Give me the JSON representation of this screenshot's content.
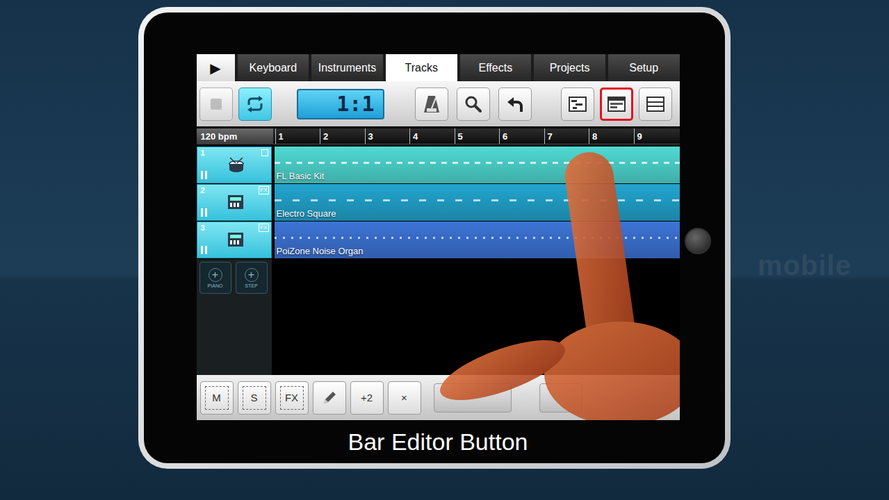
{
  "play_button": "▶",
  "tabs": [
    {
      "label": "Keyboard",
      "selected": false
    },
    {
      "label": "Instruments",
      "selected": false
    },
    {
      "label": "Tracks",
      "selected": true
    },
    {
      "label": "Effects",
      "selected": false
    },
    {
      "label": "Projects",
      "selected": false
    },
    {
      "label": "Setup",
      "selected": false
    }
  ],
  "toolbar": {
    "transport": [
      {
        "kind": "stop",
        "selected": false,
        "disabled": true
      },
      {
        "kind": "loop",
        "selected": true,
        "disabled": false
      }
    ],
    "display": "1:1",
    "tools": [
      {
        "kind": "metronome"
      },
      {
        "kind": "zoom"
      },
      {
        "kind": "undo"
      }
    ],
    "views": [
      {
        "kind": "piano-roll",
        "selected": false
      },
      {
        "kind": "bar-editor",
        "selected": true
      },
      {
        "kind": "list",
        "selected": false
      }
    ]
  },
  "tempo": "120 bpm",
  "ruler": [
    "1",
    "2",
    "3",
    "4",
    "5",
    "6",
    "7",
    "8",
    "9"
  ],
  "tracks": [
    {
      "number": "1",
      "name": "FL Basic Kit",
      "kind": "drum",
      "badge": "",
      "color": "#4fd9d2"
    },
    {
      "number": "2",
      "name": "Electro Square",
      "kind": "synth",
      "badge": "FX",
      "color": "#22a5cf"
    },
    {
      "number": "3",
      "name": "PoiZone Noise Organ",
      "kind": "synth",
      "badge": "FX",
      "color": "#3d74d6"
    }
  ],
  "add_buttons": [
    {
      "symbol": "+",
      "label": "PIANO"
    },
    {
      "symbol": "+",
      "label": "STEP"
    }
  ],
  "bottom_tools": [
    {
      "kind": "text",
      "label": "M"
    },
    {
      "kind": "text",
      "label": "S"
    },
    {
      "kind": "text",
      "label": "FX"
    },
    {
      "kind": "pencil",
      "label": ""
    },
    {
      "kind": "text",
      "label": "+2"
    },
    {
      "kind": "text",
      "label": "×"
    }
  ],
  "caption": "Bar Editor Button",
  "watermark": "mobile"
}
